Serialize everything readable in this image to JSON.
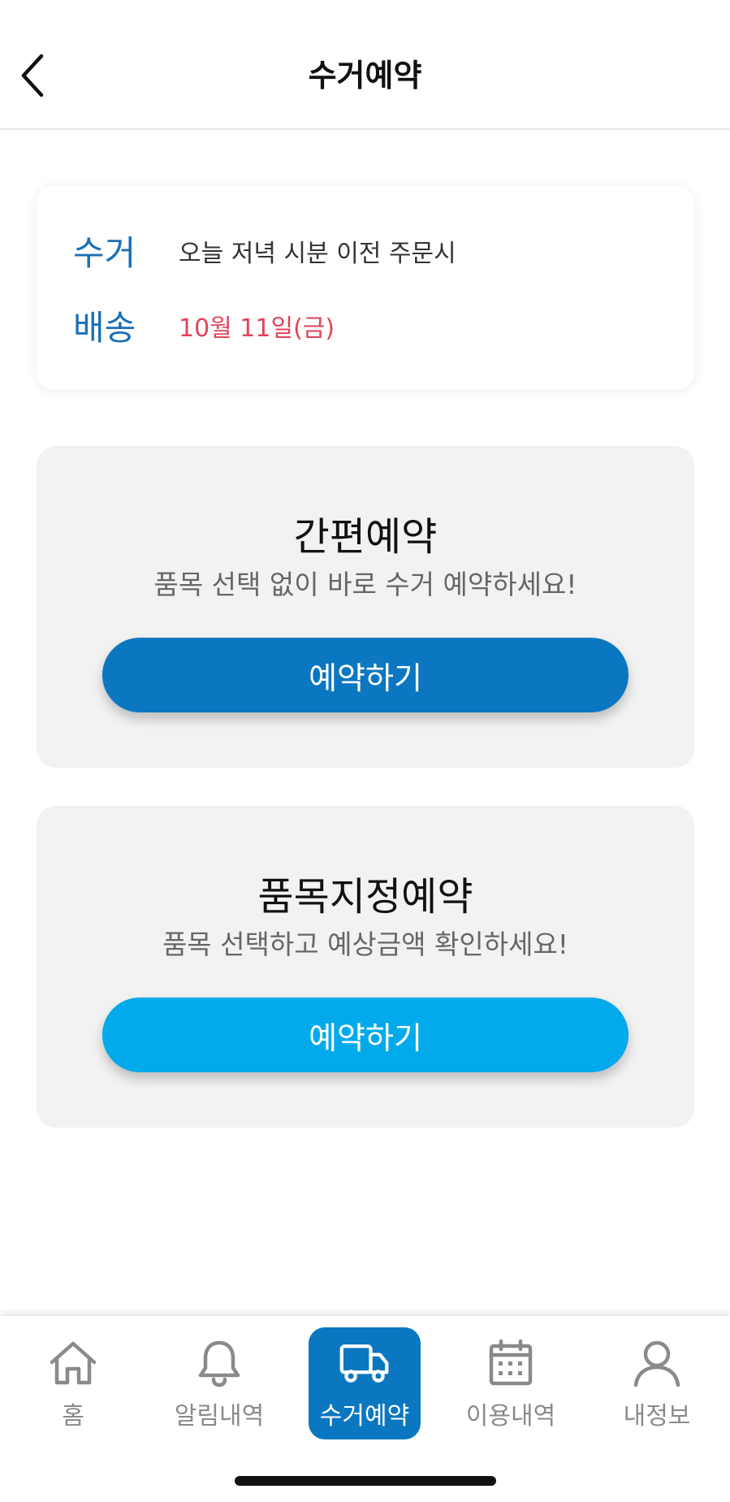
{
  "header": {
    "title": "수거예약",
    "back_icon": "chevron-left-icon"
  },
  "info": {
    "pickup_label": "수거",
    "pickup_value": "오늘 저녁 시분 이전 주문시",
    "delivery_label": "배송",
    "delivery_value": "10월 11일(금)",
    "colors": {
      "label": "#1a6fb5",
      "delivery_value": "#e0435a"
    }
  },
  "quick_reservation": {
    "title": "간편예약",
    "subtitle": "품목 선택 없이 바로 수거 예약하세요!",
    "button_label": "예약하기",
    "button_color": "#0b77c0"
  },
  "item_reservation": {
    "title": "품목지정예약",
    "subtitle": "품목 선택하고 예상금액 확인하세요!",
    "button_label": "예약하기",
    "button_color": "#02aaeb"
  },
  "tabbar": {
    "active_color": "#0b77c0",
    "items": [
      {
        "label": "홈",
        "icon": "home-icon",
        "active": false
      },
      {
        "label": "알림내역",
        "icon": "bell-icon",
        "active": false
      },
      {
        "label": "수거예약",
        "icon": "truck-icon",
        "active": true
      },
      {
        "label": "이용내역",
        "icon": "calendar-icon",
        "active": false
      },
      {
        "label": "내정보",
        "icon": "user-icon",
        "active": false
      }
    ]
  }
}
